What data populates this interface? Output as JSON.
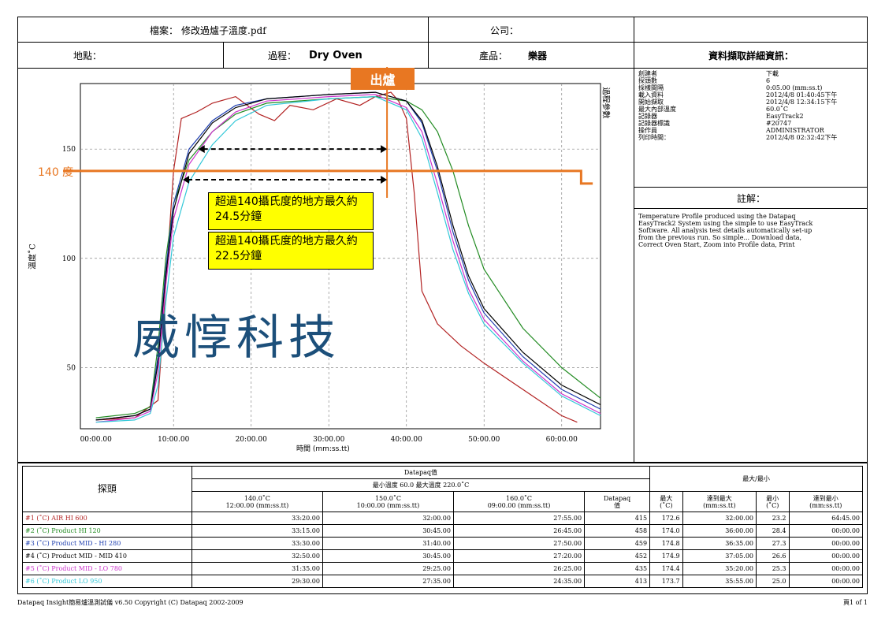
{
  "header": {
    "file_label": "檔案：",
    "file_value": "修改過爐子溫度.pdf",
    "company_label": "公司：",
    "location_label": "地點：",
    "process_label": "過程：",
    "process_value": "Dry Oven",
    "product_label": "產品：",
    "product_value": "樂器",
    "details_title": "資料擷取詳細資訊："
  },
  "details": {
    "labels": [
      "創建者",
      "探頭數",
      "採樣間隔",
      "載入資料",
      "開始擷取",
      "最大內部溫度",
      "記錄器",
      "記錄器標識",
      "操作員",
      "列印時間："
    ],
    "values": [
      "下載",
      "6",
      "0:05.00 (mm:ss.t)",
      "2012/4/8 01:40:45下午",
      "2012/4/8 12:34:15下午",
      "60.0˚C",
      "EasyTrack2",
      "#20747",
      "ADMINISTRATOR",
      "2012/4/8 02:32:42下午"
    ]
  },
  "notes": {
    "title": "註解：",
    "text": "Temperature Profile produced using the Datapaq EasyTrack2 System using the simple to use EasyTrack Software. All analysis test details automatically set-up from the previous run. So simple... Download data, Correct Oven Start, Zoom into Profile data, Print"
  },
  "annotations": {
    "exit_label": "出爐",
    "threshold_label": "140 度",
    "box1": "超過140攝氏度的地方最久約24.5分鐘",
    "box2": "超過140攝氏度的地方最久約22.5分鐘",
    "watermark": "威惇科技",
    "right_vertical": "過程參數",
    "orange": "#E87722"
  },
  "chart_data": {
    "type": "line",
    "xlabel": "時間 (mm:ss.tt)",
    "ylabel": "溫度˚C",
    "xlim": [
      -2,
      65
    ],
    "ylim": [
      22,
      180
    ],
    "xticks": [
      "00:00.00",
      "10:00.00",
      "20:00.00",
      "30:00.00",
      "40:00.00",
      "50:00.00",
      "60:00.00"
    ],
    "yticks": [
      50,
      100,
      150
    ],
    "grid": true,
    "threshold": 140,
    "exit_time": 37.5,
    "series": [
      {
        "name": "#1 (˚C) AIR HI 600",
        "color": "#b22222",
        "points": [
          [
            0,
            26
          ],
          [
            5,
            27
          ],
          [
            8,
            35
          ],
          [
            10,
            140
          ],
          [
            11,
            164
          ],
          [
            13,
            167
          ],
          [
            15,
            171
          ],
          [
            18,
            174
          ],
          [
            21,
            166
          ],
          [
            23,
            163
          ],
          [
            25,
            170
          ],
          [
            28,
            168
          ],
          [
            31,
            173
          ],
          [
            34,
            170
          ],
          [
            36,
            174
          ],
          [
            38,
            176
          ],
          [
            39,
            172
          ],
          [
            40,
            164
          ],
          [
            41,
            130
          ],
          [
            42,
            85
          ],
          [
            44,
            70
          ],
          [
            47,
            60
          ],
          [
            50,
            52
          ],
          [
            55,
            40
          ],
          [
            60,
            28
          ],
          [
            62,
            25
          ]
        ]
      },
      {
        "name": "#2 (˚C) Product HI 120",
        "color": "#228b22",
        "points": [
          [
            0,
            27
          ],
          [
            5,
            29
          ],
          [
            7,
            32
          ],
          [
            8,
            60
          ],
          [
            9,
            100
          ],
          [
            10,
            125
          ],
          [
            12,
            145
          ],
          [
            15,
            158
          ],
          [
            18,
            166
          ],
          [
            22,
            171
          ],
          [
            30,
            173
          ],
          [
            36,
            174
          ],
          [
            40,
            172
          ],
          [
            42,
            168
          ],
          [
            44,
            158
          ],
          [
            46,
            140
          ],
          [
            48,
            115
          ],
          [
            50,
            95
          ],
          [
            55,
            68
          ],
          [
            60,
            50
          ],
          [
            65,
            36
          ]
        ]
      },
      {
        "name": "#3 (˚C) Product MID - HI 280",
        "color": "#1f3fb0",
        "points": [
          [
            0,
            26
          ],
          [
            5,
            28
          ],
          [
            7,
            31
          ],
          [
            8,
            55
          ],
          [
            9,
            95
          ],
          [
            10,
            125
          ],
          [
            12,
            150
          ],
          [
            15,
            163
          ],
          [
            18,
            170
          ],
          [
            22,
            173
          ],
          [
            30,
            175
          ],
          [
            36,
            176
          ],
          [
            40,
            172
          ],
          [
            42,
            162
          ],
          [
            44,
            140
          ],
          [
            46,
            112
          ],
          [
            48,
            90
          ],
          [
            50,
            75
          ],
          [
            55,
            55
          ],
          [
            60,
            40
          ],
          [
            65,
            31
          ]
        ]
      },
      {
        "name": "#4 (˚C) Product MID - MID 410",
        "color": "#000000",
        "points": [
          [
            0,
            26
          ],
          [
            5,
            28
          ],
          [
            7,
            31
          ],
          [
            8,
            52
          ],
          [
            9,
            92
          ],
          [
            10,
            122
          ],
          [
            12,
            148
          ],
          [
            15,
            162
          ],
          [
            18,
            169
          ],
          [
            22,
            173
          ],
          [
            30,
            175
          ],
          [
            36,
            176
          ],
          [
            40,
            172
          ],
          [
            42,
            163
          ],
          [
            44,
            142
          ],
          [
            46,
            115
          ],
          [
            48,
            92
          ],
          [
            50,
            77
          ],
          [
            55,
            57
          ],
          [
            60,
            42
          ],
          [
            65,
            33
          ]
        ]
      },
      {
        "name": "#5 (˚C) Product MID - LO 780",
        "color": "#cc33cc",
        "points": [
          [
            0,
            25
          ],
          [
            5,
            27
          ],
          [
            7,
            30
          ],
          [
            8,
            48
          ],
          [
            9,
            88
          ],
          [
            10,
            118
          ],
          [
            12,
            143
          ],
          [
            15,
            158
          ],
          [
            18,
            167
          ],
          [
            22,
            172
          ],
          [
            30,
            174
          ],
          [
            36,
            175
          ],
          [
            40,
            169
          ],
          [
            42,
            158
          ],
          [
            44,
            134
          ],
          [
            46,
            108
          ],
          [
            48,
            86
          ],
          [
            50,
            72
          ],
          [
            55,
            53
          ],
          [
            60,
            38
          ],
          [
            65,
            29
          ]
        ]
      },
      {
        "name": "#6 (˚C) Product LO 950",
        "color": "#33c8d8",
        "points": [
          [
            0,
            25
          ],
          [
            5,
            26
          ],
          [
            7,
            29
          ],
          [
            8,
            42
          ],
          [
            9,
            80
          ],
          [
            10,
            110
          ],
          [
            12,
            135
          ],
          [
            15,
            152
          ],
          [
            18,
            163
          ],
          [
            22,
            170
          ],
          [
            30,
            173
          ],
          [
            36,
            174
          ],
          [
            40,
            168
          ],
          [
            42,
            155
          ],
          [
            44,
            130
          ],
          [
            46,
            104
          ],
          [
            48,
            84
          ],
          [
            50,
            70
          ],
          [
            55,
            52
          ],
          [
            60,
            37
          ],
          [
            65,
            28
          ]
        ]
      }
    ]
  },
  "table": {
    "probe_header": "探頭",
    "datapaq_title": "Datapaq值",
    "datapaq_sub": "最小溫度 60.0 最大溫度 220.0˚C",
    "col_140": [
      "140.0˚C",
      "12:00.00 (mm:ss.tt)"
    ],
    "col_150": [
      "150.0˚C",
      "10:00.00 (mm:ss.tt)"
    ],
    "col_160": [
      "160.0˚C",
      "09:00.00 (mm:ss.tt)"
    ],
    "col_dq": [
      "Datapaq",
      "值"
    ],
    "maxmin_title": "最大/最小",
    "col_max": [
      "最大",
      "(˚C)"
    ],
    "col_tmax": [
      "達到最大",
      "(mm:ss.tt)"
    ],
    "col_min": [
      "最小",
      "(˚C)"
    ],
    "col_tmin": [
      "達到最小",
      "(mm:ss.tt)"
    ],
    "rows": [
      {
        "name": "#1 (˚C) AIR HI 600",
        "color": "#b22222",
        "v140": "33:20.00",
        "v150": "32:00.00",
        "v160": "27:55.00",
        "dq": "415",
        "max": "172.6",
        "tmax": "32:00.00",
        "min": "23.2",
        "tmin": "64:45.00"
      },
      {
        "name": "#2 (˚C) Product HI 120",
        "color": "#228b22",
        "v140": "33:15.00",
        "v150": "30:45.00",
        "v160": "26:45.00",
        "dq": "458",
        "max": "174.0",
        "tmax": "36:00.00",
        "min": "28.4",
        "tmin": "00:00.00"
      },
      {
        "name": "#3 (˚C) Product MID - HI 280",
        "color": "#1f3fb0",
        "v140": "33:30.00",
        "v150": "31:40.00",
        "v160": "27:50.00",
        "dq": "459",
        "max": "174.8",
        "tmax": "36:35.00",
        "min": "27.3",
        "tmin": "00:00.00"
      },
      {
        "name": "#4 (˚C) Product MID - MID 410",
        "color": "#000000",
        "v140": "32:50.00",
        "v150": "30:45.00",
        "v160": "27:20.00",
        "dq": "452",
        "max": "174.9",
        "tmax": "37:05.00",
        "min": "26.6",
        "tmin": "00:00.00"
      },
      {
        "name": "#5 (˚C) Product MID - LO 780",
        "color": "#cc33cc",
        "v140": "31:35.00",
        "v150": "29:25.00",
        "v160": "26:25.00",
        "dq": "435",
        "max": "174.4",
        "tmax": "35:20.00",
        "min": "25.3",
        "tmin": "00:00.00"
      },
      {
        "name": "#6 (˚C) Product LO 950",
        "color": "#33c8d8",
        "v140": "29:30.00",
        "v150": "27:35.00",
        "v160": "24:35.00",
        "dq": "413",
        "max": "173.7",
        "tmax": "35:55.00",
        "min": "25.0",
        "tmin": "00:00.00"
      }
    ]
  },
  "footer": {
    "left": "Datapaq Insight簡易爐溫測試儀 v6.50 Copyright (C) Datapaq 2002-2009",
    "right": "頁1 of 1"
  }
}
